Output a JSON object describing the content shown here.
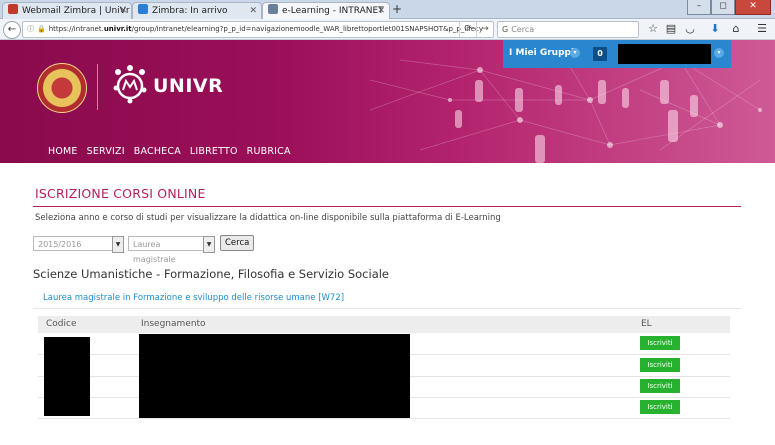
{
  "browser": {
    "tabs": [
      {
        "title": "Webmail Zimbra | UniVr",
        "color": "#c0392b"
      },
      {
        "title": "Zimbra: In arrivo",
        "color": "#2a7fd4"
      },
      {
        "title": "e-Learning - INTRANET",
        "color": "#6a7f99"
      }
    ],
    "new_tab": "+",
    "url": {
      "prefix": "https://intranet.",
      "domain": "univr.it",
      "rest": "/group/intranet/elearning?p_p_id=navigazionemoodle_WAR_librettoportlet001SNAPSHOT&p_p_lifecy"
    },
    "search_placeholder": "Cerca",
    "window_buttons": [
      "–",
      "◻",
      "✕"
    ]
  },
  "header": {
    "brand": "UNIVR",
    "menu": [
      "HOME",
      "SERVIZI",
      "BACHECA",
      "LIBRETTO",
      "RUBRICA"
    ],
    "groups_label": "I Miei Gruppi",
    "groups_count": "0",
    "brand_color": "#9a0f58",
    "groups_color": "#2a87cf"
  },
  "page": {
    "title": "ISCRIZIONE CORSI ONLINE",
    "intro": "Seleziona anno e corso di studi per visualizzare la didattica on-line disponibile sulla piattaforma di E-Learning",
    "year_select": "2015/2016",
    "course_select": "Laurea magistrale",
    "search_button": "Cerca",
    "department": "Scienze Umanistiche - Formazione, Filosofia e Servizio Sociale",
    "degree": "Laurea magistrale in Formazione e sviluppo delle risorse umane [W72]",
    "table": {
      "headers": [
        "Codice",
        "Insegnamento",
        "EL"
      ],
      "rows": [
        {
          "action": "Iscriviti"
        },
        {
          "action": "Iscriviti"
        },
        {
          "action": "Iscriviti"
        },
        {
          "action": "Iscriviti"
        }
      ]
    },
    "accent_color": "#b41f5e",
    "link_color": "#1c8dcf",
    "action_color": "#26b22e"
  }
}
